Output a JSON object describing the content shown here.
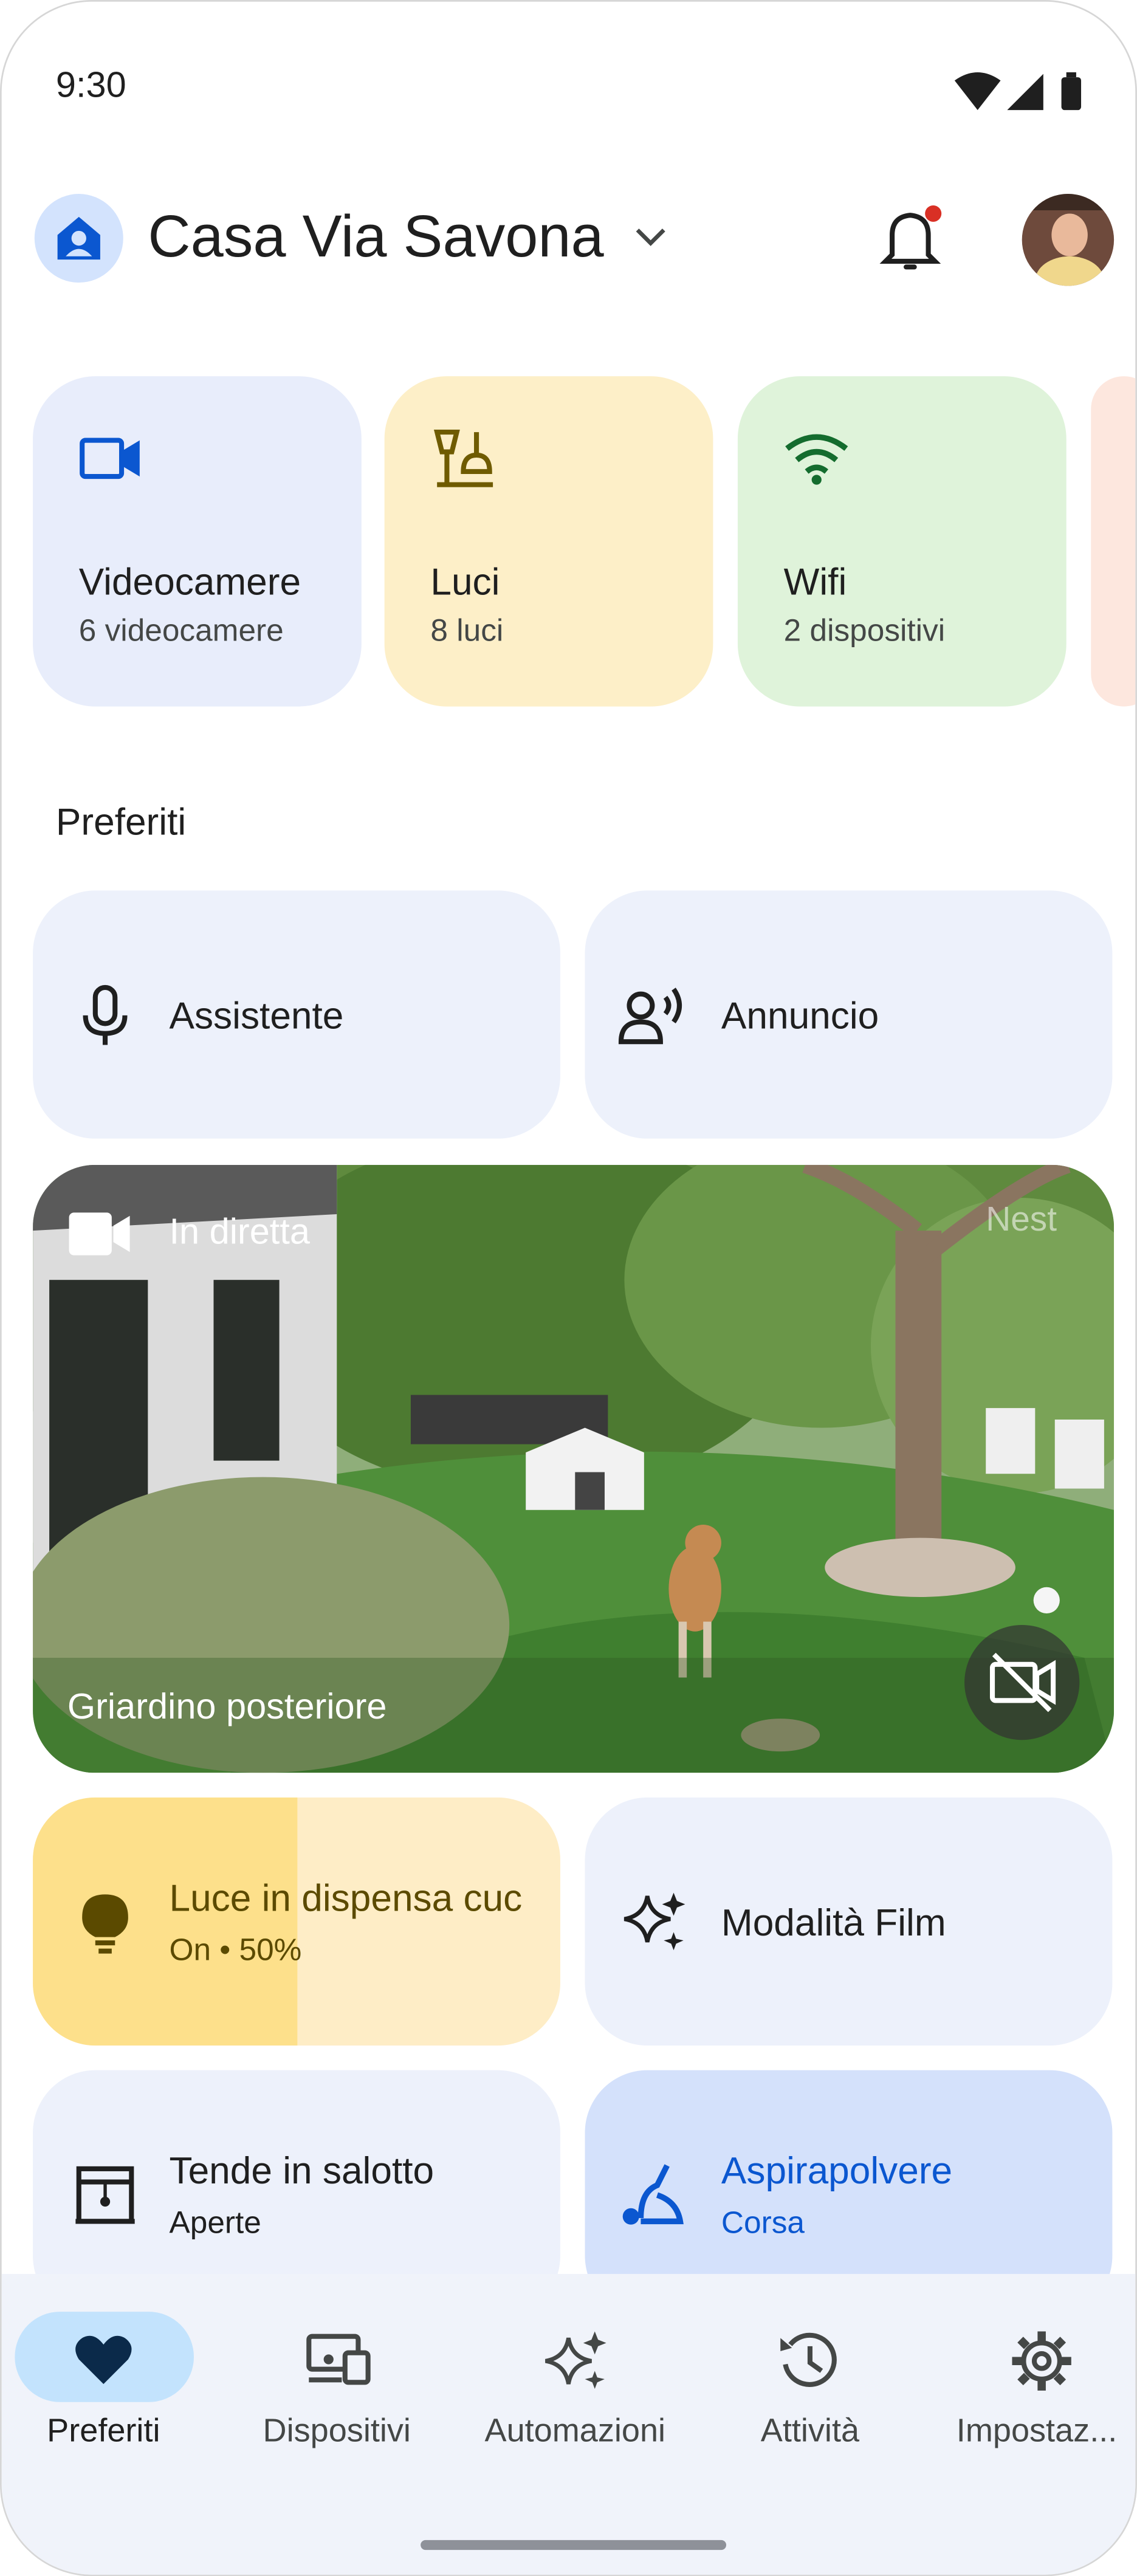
{
  "status_bar": {
    "time": "9:30"
  },
  "header": {
    "home_name": "Casa Via Savona"
  },
  "chips": [
    {
      "title": "Videocamere",
      "subtitle": "6 videocamere",
      "icon": "videocam-icon",
      "color": "#e8edfb",
      "icon_color": "#0b57d0"
    },
    {
      "title": "Luci",
      "subtitle": "8 luci",
      "icon": "lamp-icon",
      "color": "#fdefc8",
      "icon_color": "#6f5b00"
    },
    {
      "title": "Wifi",
      "subtitle": "2 dispositivi",
      "icon": "wifi-icon",
      "color": "#dff3da",
      "icon_color": "#146c2e"
    }
  ],
  "section_title": "Preferiti",
  "favorites": {
    "assistant_label": "Assistente",
    "announce_label": "Annuncio"
  },
  "camera": {
    "live_label": "In diretta",
    "watermark": "Nest",
    "name": "Griardino posteriore"
  },
  "tiles": {
    "light": {
      "title": "Luce in dispensa cuc",
      "status": "On • 50%",
      "brightness": 0.5
    },
    "movie": {
      "title": "Modalità Film"
    },
    "blinds": {
      "title": "Tende in salotto",
      "status": "Aperte"
    },
    "vacuum": {
      "title": "Aspirapolvere",
      "status": "Corsa"
    }
  },
  "bottom_nav": [
    {
      "label": "Preferiti",
      "icon": "heart-icon",
      "active": true
    },
    {
      "label": "Dispositivi",
      "icon": "devices-icon",
      "active": false
    },
    {
      "label": "Automazioni",
      "icon": "sparkle-icon",
      "active": false
    },
    {
      "label": "Attività",
      "icon": "history-icon",
      "active": false
    },
    {
      "label": "Impostaz...",
      "icon": "gear-icon",
      "active": false
    }
  ],
  "colors": {
    "accent": "#0b57d0",
    "tile_bg": "#edf1fb",
    "light_on": "#fde08b",
    "light_off": "#feedc6",
    "vacuum_bg": "#d4e1fb",
    "nav_bg": "#f0f3fa",
    "nav_active": "#c3e3fd",
    "notification_dot": "#d93025"
  }
}
